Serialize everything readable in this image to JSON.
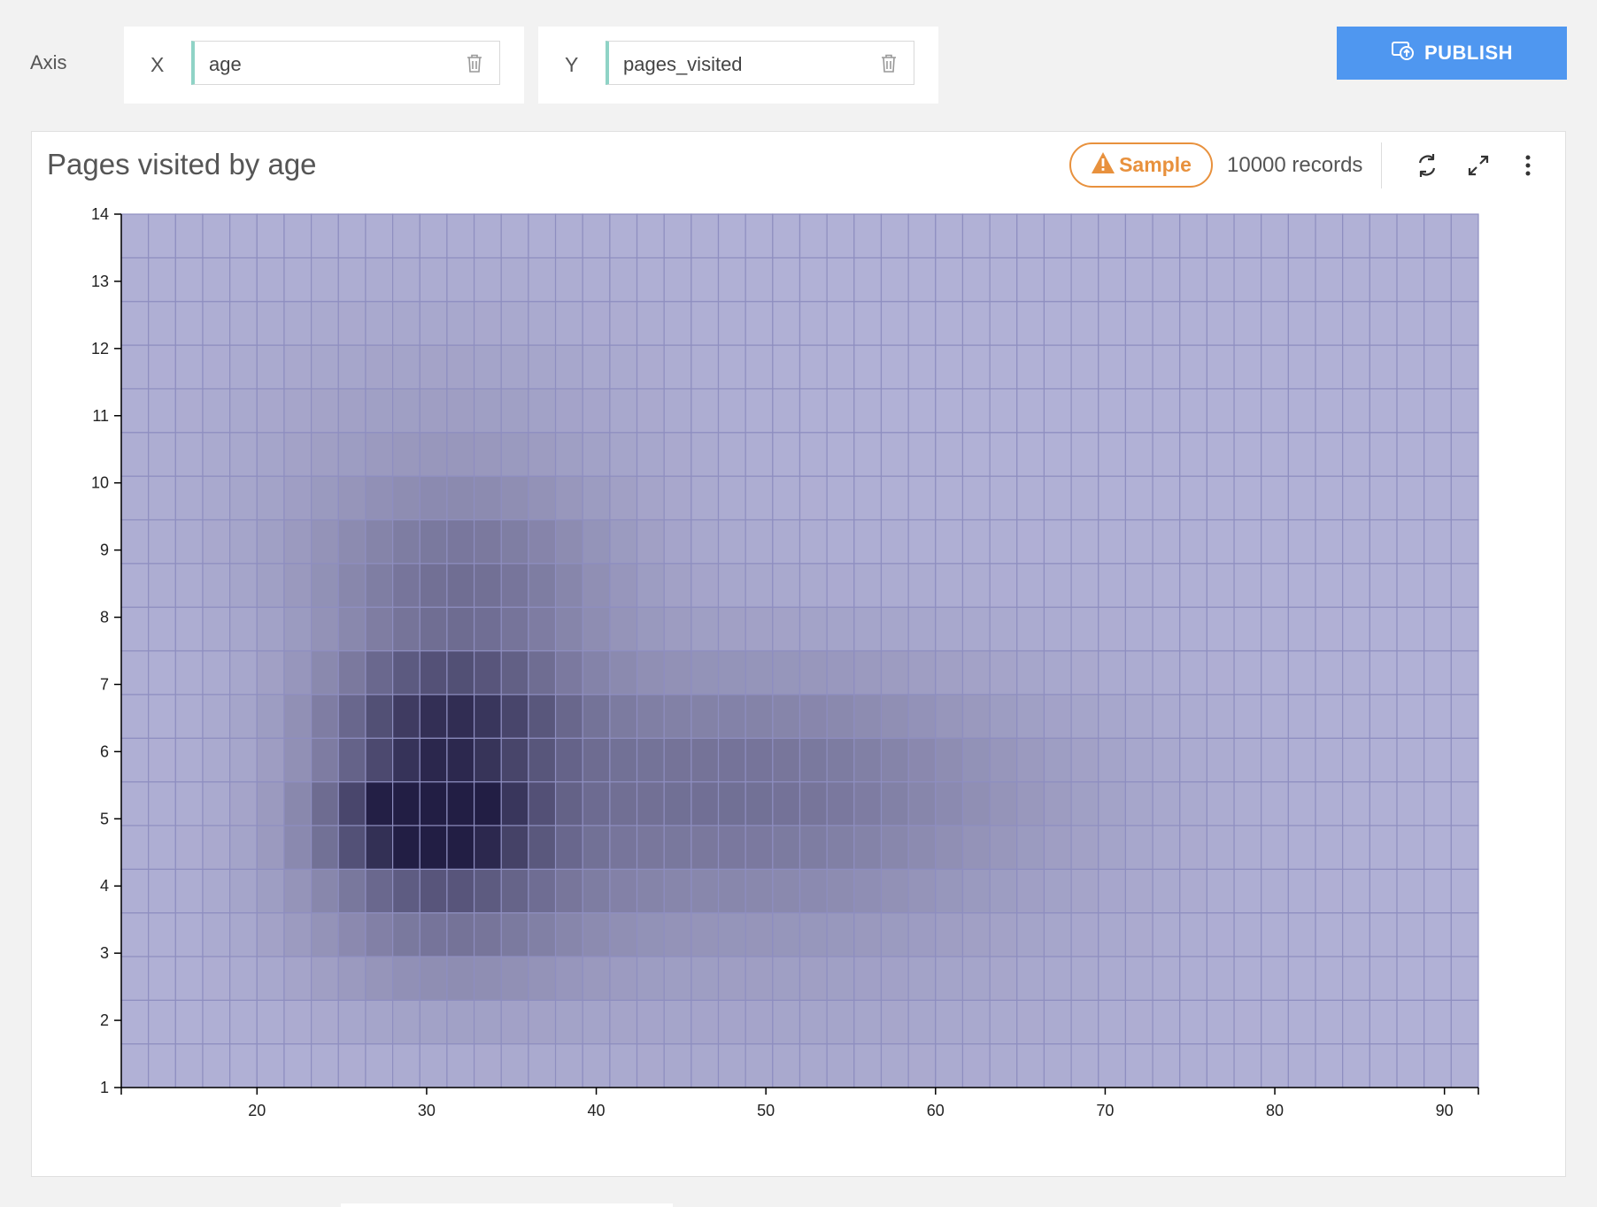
{
  "toolbar": {
    "axis_label": "Axis",
    "x_letter": "X",
    "x_field": "age",
    "y_letter": "Y",
    "y_field": "pages_visited",
    "publish_label": "PUBLISH",
    "publish_icon": "cloud-upload-icon",
    "accent_color": "#4f97f0",
    "field_accent_color": "#8fd3c6"
  },
  "card": {
    "title": "Pages visited by age",
    "sample_label": "Sample",
    "sample_color": "#e8913d",
    "records_text": "10000 records",
    "icons": [
      "refresh-icon",
      "expand-icon",
      "more-vertical-icon"
    ]
  },
  "chart_data": {
    "type": "heatmap",
    "title": "Pages visited by age",
    "xlabel": "",
    "ylabel": "",
    "x_ticks": [
      20,
      30,
      40,
      50,
      60,
      70,
      80,
      90
    ],
    "y_ticks": [
      1,
      2,
      3,
      4,
      5,
      6,
      7,
      8,
      9,
      10,
      11,
      12,
      13,
      14
    ],
    "xlim": [
      12,
      92
    ],
    "ylim": [
      1,
      14
    ],
    "x_bin_width": 1.6,
    "y_bin_height": 0.65,
    "x_bins": 50,
    "y_bins": 20,
    "color_low": "#b1b1d6",
    "color_high": "#221e44",
    "grid_line_color": "#8e8ec0",
    "hot_spots": [
      {
        "x": 30,
        "y": 5.0,
        "sx": 4,
        "sy": 0.55,
        "w": 1.0
      },
      {
        "x": 31,
        "y": 6.5,
        "sx": 5,
        "sy": 0.7,
        "w": 0.75
      },
      {
        "x": 31,
        "y": 3.8,
        "sx": 6,
        "sy": 1.0,
        "w": 0.42
      },
      {
        "x": 32,
        "y": 8.5,
        "sx": 6,
        "sy": 0.9,
        "w": 0.35
      },
      {
        "x": 47,
        "y": 5.5,
        "sx": 12,
        "sy": 1.2,
        "w": 0.33
      },
      {
        "x": 50,
        "y": 4.5,
        "sx": 14,
        "sy": 2.2,
        "w": 0.17
      },
      {
        "x": 31,
        "y": 10,
        "sx": 9,
        "sy": 1.8,
        "w": 0.16
      }
    ]
  }
}
